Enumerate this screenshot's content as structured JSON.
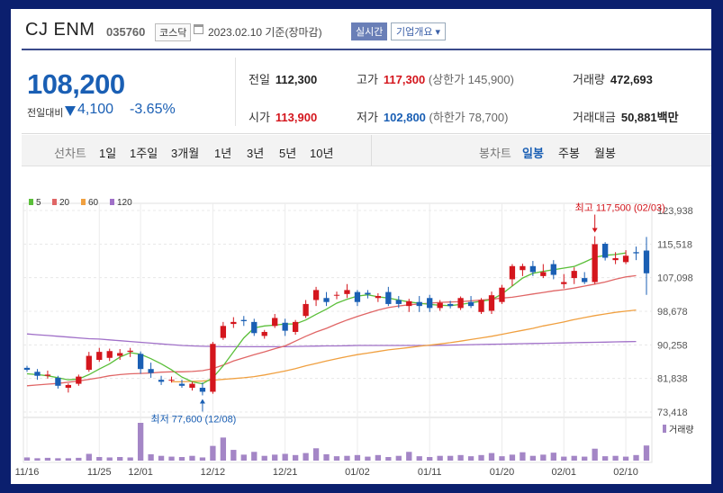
{
  "header": {
    "name": "CJ ENM",
    "code": "035760",
    "market_badge": "코스닥",
    "date": "2023.02.10 기준(장마감)",
    "realtime_button": "실시간",
    "company_button": "기업개요 ▾"
  },
  "summary": {
    "price": "108,200",
    "change_label": "전일대비",
    "change": "4,100",
    "change_pct": "-3.65%",
    "prev_close_label": "전일",
    "prev_close": "112,300",
    "high_label": "고가",
    "high": "117,300",
    "upper_limit_label": "(상한가 145,900)",
    "volume_label": "거래량",
    "volume": "472,693",
    "open_label": "시가",
    "open": "113,900",
    "low_label": "저가",
    "low": "102,800",
    "lower_limit_label": "(하한가 78,700)",
    "amount_label": "거래대금",
    "amount": "50,881",
    "amount_unit": "백만"
  },
  "tabs": {
    "line_chart_label": "선차트",
    "periods": [
      "1일",
      "1주일",
      "3개월",
      "1년",
      "3년",
      "5년",
      "10년"
    ],
    "candle_label": "봉차트",
    "candle_periods": [
      "일봉",
      "주봉",
      "월봉"
    ],
    "active_candle": "일봉"
  },
  "colors": {
    "up": "#d4161d",
    "down": "#1a5fb4",
    "ma5": "#5bbf3a",
    "ma20": "#e06666",
    "ma60": "#f0a040",
    "ma120": "#a070c8",
    "volume": "#a486c6"
  },
  "chart_data": {
    "type": "candlestick",
    "legend": [
      "5",
      "20",
      "60",
      "120"
    ],
    "y_ticks": [
      "123,938",
      "115,518",
      "107,098",
      "98,678",
      "90,258",
      "81,838",
      "73,418"
    ],
    "ylim": [
      73418,
      123938
    ],
    "x_ticks": [
      {
        "label": "11/16",
        "i": 0
      },
      {
        "label": "11/25",
        "i": 7
      },
      {
        "label": "12/01",
        "i": 11
      },
      {
        "label": "12/12",
        "i": 18
      },
      {
        "label": "12/21",
        "i": 25
      },
      {
        "label": "01/02",
        "i": 32
      },
      {
        "label": "01/11",
        "i": 39
      },
      {
        "label": "01/20",
        "i": 46
      },
      {
        "label": "02/01",
        "i": 52
      },
      {
        "label": "02/10",
        "i": 58
      }
    ],
    "high_annotation": "최고 117,500 (02/03)",
    "low_annotation": "최저 77,600 (12/08)",
    "volume_legend": "거래량",
    "candles": [
      [
        84500,
        85000,
        83500,
        84000
      ],
      [
        83500,
        84200,
        81500,
        82500
      ],
      [
        82500,
        83800,
        81800,
        82800
      ],
      [
        82000,
        82500,
        79300,
        80000
      ],
      [
        79500,
        80600,
        78300,
        80200
      ],
      [
        80500,
        82800,
        80000,
        82300
      ],
      [
        84000,
        88500,
        83500,
        87500
      ],
      [
        86500,
        89500,
        86000,
        88500
      ],
      [
        87000,
        89300,
        86200,
        88700
      ],
      [
        87500,
        89200,
        86500,
        88200
      ],
      [
        88500,
        89500,
        87200,
        88800
      ],
      [
        88000,
        88600,
        83000,
        84200
      ],
      [
        84200,
        85800,
        82000,
        83200
      ],
      [
        81500,
        82500,
        80200,
        81000
      ],
      [
        81500,
        82300,
        80800,
        81500
      ],
      [
        80500,
        81500,
        79500,
        80000
      ],
      [
        79500,
        81000,
        78800,
        80500
      ],
      [
        79500,
        80800,
        77600,
        78500
      ],
      [
        78500,
        91000,
        78000,
        90500
      ],
      [
        92000,
        96000,
        91500,
        95000
      ],
      [
        95500,
        97200,
        94500,
        96000
      ],
      [
        96500,
        97500,
        95000,
        96200
      ],
      [
        96000,
        96800,
        92500,
        93200
      ],
      [
        92500,
        94000,
        91800,
        93500
      ],
      [
        95000,
        98000,
        94500,
        97000
      ],
      [
        95800,
        96800,
        92500,
        93800
      ],
      [
        93500,
        96500,
        92800,
        96000
      ],
      [
        97500,
        101500,
        97000,
        100500
      ],
      [
        101500,
        104800,
        100000,
        104000
      ],
      [
        102000,
        103500,
        100000,
        101000
      ],
      [
        102800,
        103600,
        101700,
        102800
      ],
      [
        103000,
        105500,
        102000,
        104000
      ],
      [
        103500,
        104000,
        100000,
        101000
      ],
      [
        103300,
        104000,
        101900,
        102900
      ],
      [
        102000,
        103200,
        101000,
        102500
      ],
      [
        103500,
        104800,
        100000,
        100500
      ],
      [
        101500,
        102500,
        99500,
        100500
      ],
      [
        100000,
        101800,
        98500,
        101200
      ],
      [
        101000,
        102500,
        98500,
        100000
      ],
      [
        102000,
        102800,
        98500,
        99500
      ],
      [
        99500,
        101500,
        98800,
        100800
      ],
      [
        100500,
        101300,
        99400,
        100000
      ],
      [
        99500,
        102400,
        99000,
        102000
      ],
      [
        101000,
        102500,
        99500,
        100000
      ],
      [
        98500,
        102000,
        98000,
        101500
      ],
      [
        98800,
        103600,
        98000,
        102700
      ],
      [
        101000,
        105300,
        100500,
        104600
      ],
      [
        106700,
        110500,
        105000,
        110000
      ],
      [
        109000,
        110600,
        107500,
        110000
      ],
      [
        110000,
        111300,
        107500,
        108500
      ],
      [
        107500,
        110500,
        107000,
        108500
      ],
      [
        110500,
        111500,
        106700,
        107800
      ],
      [
        105500,
        108000,
        104400,
        106000
      ],
      [
        107000,
        109700,
        105500,
        108800
      ],
      [
        107000,
        108500,
        105500,
        106000
      ],
      [
        106000,
        117500,
        105500,
        115500
      ],
      [
        115600,
        116000,
        111400,
        112100
      ],
      [
        111500,
        113500,
        110500,
        112000
      ],
      [
        111000,
        114000,
        110500,
        112600
      ],
      [
        113500,
        114900,
        111500,
        113200
      ],
      [
        113900,
        117300,
        102800,
        108200
      ]
    ],
    "ma5": [
      83000,
      82800,
      82500,
      82000,
      81500,
      81700,
      82800,
      84200,
      85500,
      87200,
      88300,
      87900,
      86800,
      85500,
      84000,
      82200,
      81000,
      80500,
      82000,
      85000,
      88500,
      92000,
      94500,
      95000,
      95200,
      95500,
      95500,
      96500,
      97900,
      99200,
      100700,
      101700,
      102500,
      102800,
      102300,
      102000,
      101500,
      101000,
      100700,
      100400,
      100200,
      100100,
      100400,
      100800,
      101200,
      101600,
      103000,
      105000,
      107000,
      108200,
      108700,
      109100,
      109500,
      109900,
      111000,
      112200,
      112700,
      112900,
      113300
    ],
    "ma20": [
      80000,
      80200,
      80400,
      80600,
      80900,
      81200,
      81600,
      82000,
      82500,
      82800,
      83000,
      83100,
      83200,
      83400,
      83500,
      83500,
      83600,
      83800,
      84300,
      85200,
      86200,
      87000,
      87800,
      88500,
      89300,
      90000,
      91200,
      92400,
      93500,
      94400,
      95500,
      96500,
      97400,
      98200,
      99000,
      99600,
      100000,
      100300,
      100500,
      100700,
      100900,
      101000,
      101100,
      101300,
      101500,
      101700,
      102000,
      102200,
      102600,
      103000,
      103400,
      103800,
      104100,
      104500,
      105000,
      105500,
      106000,
      106700,
      107300,
      107600
    ],
    "ma60": [
      null,
      null,
      null,
      null,
      null,
      null,
      null,
      null,
      null,
      null,
      null,
      null,
      null,
      null,
      81000,
      81000,
      81100,
      81200,
      81400,
      81600,
      81800,
      82000,
      82300,
      82700,
      83200,
      83700,
      84300,
      85000,
      85600,
      86200,
      86800,
      87300,
      87800,
      88200,
      88600,
      89000,
      89300,
      89600,
      89900,
      90200,
      90500,
      90800,
      91200,
      91600,
      92000,
      92400,
      92900,
      93400,
      93900,
      94400,
      95000,
      95500,
      96000,
      96600,
      97100,
      97600,
      98000,
      98400,
      98700,
      99000
    ],
    "ma120": [
      93000,
      92800,
      92600,
      92400,
      92200,
      92000,
      91800,
      91700,
      91500,
      91300,
      91100,
      90900,
      90700,
      90500,
      90300,
      90100,
      90000,
      89900,
      89850,
      89800,
      89800,
      89800,
      89800,
      89800,
      89800,
      89800,
      89850,
      89900,
      89950,
      90000,
      90000,
      90050,
      90100,
      90100,
      90100,
      90100,
      90100,
      90100,
      90100,
      90100,
      90150,
      90200,
      90250,
      90300,
      90350,
      90400,
      90450,
      90500,
      90550,
      90600,
      90650,
      90700,
      90750,
      90800,
      90850,
      90900,
      90950,
      91000,
      91050,
      91100
    ],
    "volume": [
      8,
      6,
      7,
      6,
      6,
      7,
      17,
      9,
      8,
      9,
      8,
      95,
      16,
      12,
      10,
      9,
      12,
      8,
      37,
      58,
      27,
      15,
      22,
      12,
      15,
      17,
      14,
      19,
      31,
      16,
      11,
      12,
      14,
      10,
      14,
      9,
      12,
      22,
      11,
      9,
      12,
      12,
      14,
      11,
      14,
      19,
      11,
      15,
      21,
      12,
      15,
      20,
      10,
      12,
      10,
      30,
      11,
      12,
      10,
      14,
      38
    ]
  }
}
